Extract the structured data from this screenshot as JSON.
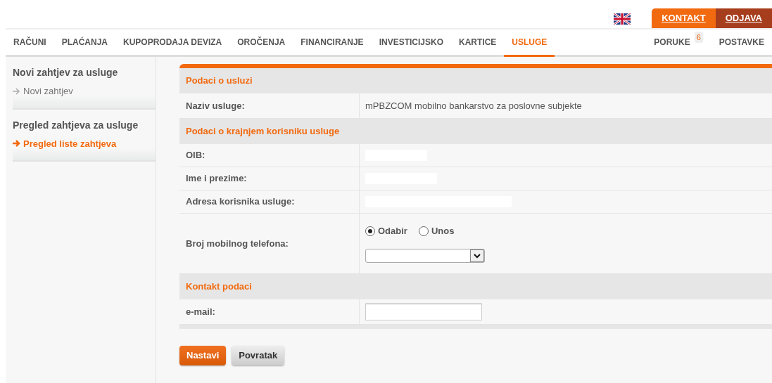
{
  "top_links": [
    {
      "label": "KONTAKT",
      "kind": "primary"
    },
    {
      "label": "ODJAVA",
      "kind": "dark"
    }
  ],
  "nav": [
    {
      "label": "RAČUNI",
      "selected": false
    },
    {
      "label": "PLAĆANJA",
      "selected": false
    },
    {
      "label": "KUPOPRODAJA DEVIZA",
      "selected": false
    },
    {
      "label": "OROČENJA",
      "selected": false
    },
    {
      "label": "FINANCIRANJE",
      "selected": false
    },
    {
      "label": "INVESTICIJSKO",
      "selected": false
    },
    {
      "label": "KARTICE",
      "selected": false
    },
    {
      "label": "USLUGE",
      "selected": true
    }
  ],
  "nav_right": [
    {
      "label": "PORUKE",
      "badge": "6"
    },
    {
      "label": "POSTAVKE"
    }
  ],
  "sidebar": [
    {
      "title": "Novi zahtjev za usluge",
      "items": [
        {
          "label": "Novi zahtjev",
          "selected": false
        }
      ]
    },
    {
      "title": "Pregled zahtjeva za usluge",
      "items": [
        {
          "label": "Pregled liste zahtjeva",
          "selected": true
        }
      ]
    }
  ],
  "form_rows": [
    {
      "kind": "section",
      "label": "Podaci o usluzi"
    },
    {
      "kind": "text",
      "label": "Naziv usluge:",
      "value": "mPBZCOM mobilno bankarstvo za poslovne subjekte"
    },
    {
      "kind": "section",
      "label": "Podaci o krajnjem korisniku usluge"
    },
    {
      "kind": "blank",
      "label": "OIB:"
    },
    {
      "kind": "blank",
      "label": "Ime i prezime:"
    },
    {
      "kind": "blank",
      "label": "Adresa korisnika usluge:"
    },
    {
      "kind": "phone",
      "label": "Broj mobilnog telefona:",
      "options": [
        {
          "label": "Odabir",
          "selected": true
        },
        {
          "label": "Unos",
          "selected": false
        }
      ]
    },
    {
      "kind": "section",
      "label": "Kontakt podaci"
    },
    {
      "kind": "input",
      "label": "e-mail:"
    }
  ],
  "buttons": [
    {
      "label": "Nastavi",
      "kind": "primary"
    },
    {
      "label": "Povratak",
      "kind": "secondary"
    }
  ]
}
